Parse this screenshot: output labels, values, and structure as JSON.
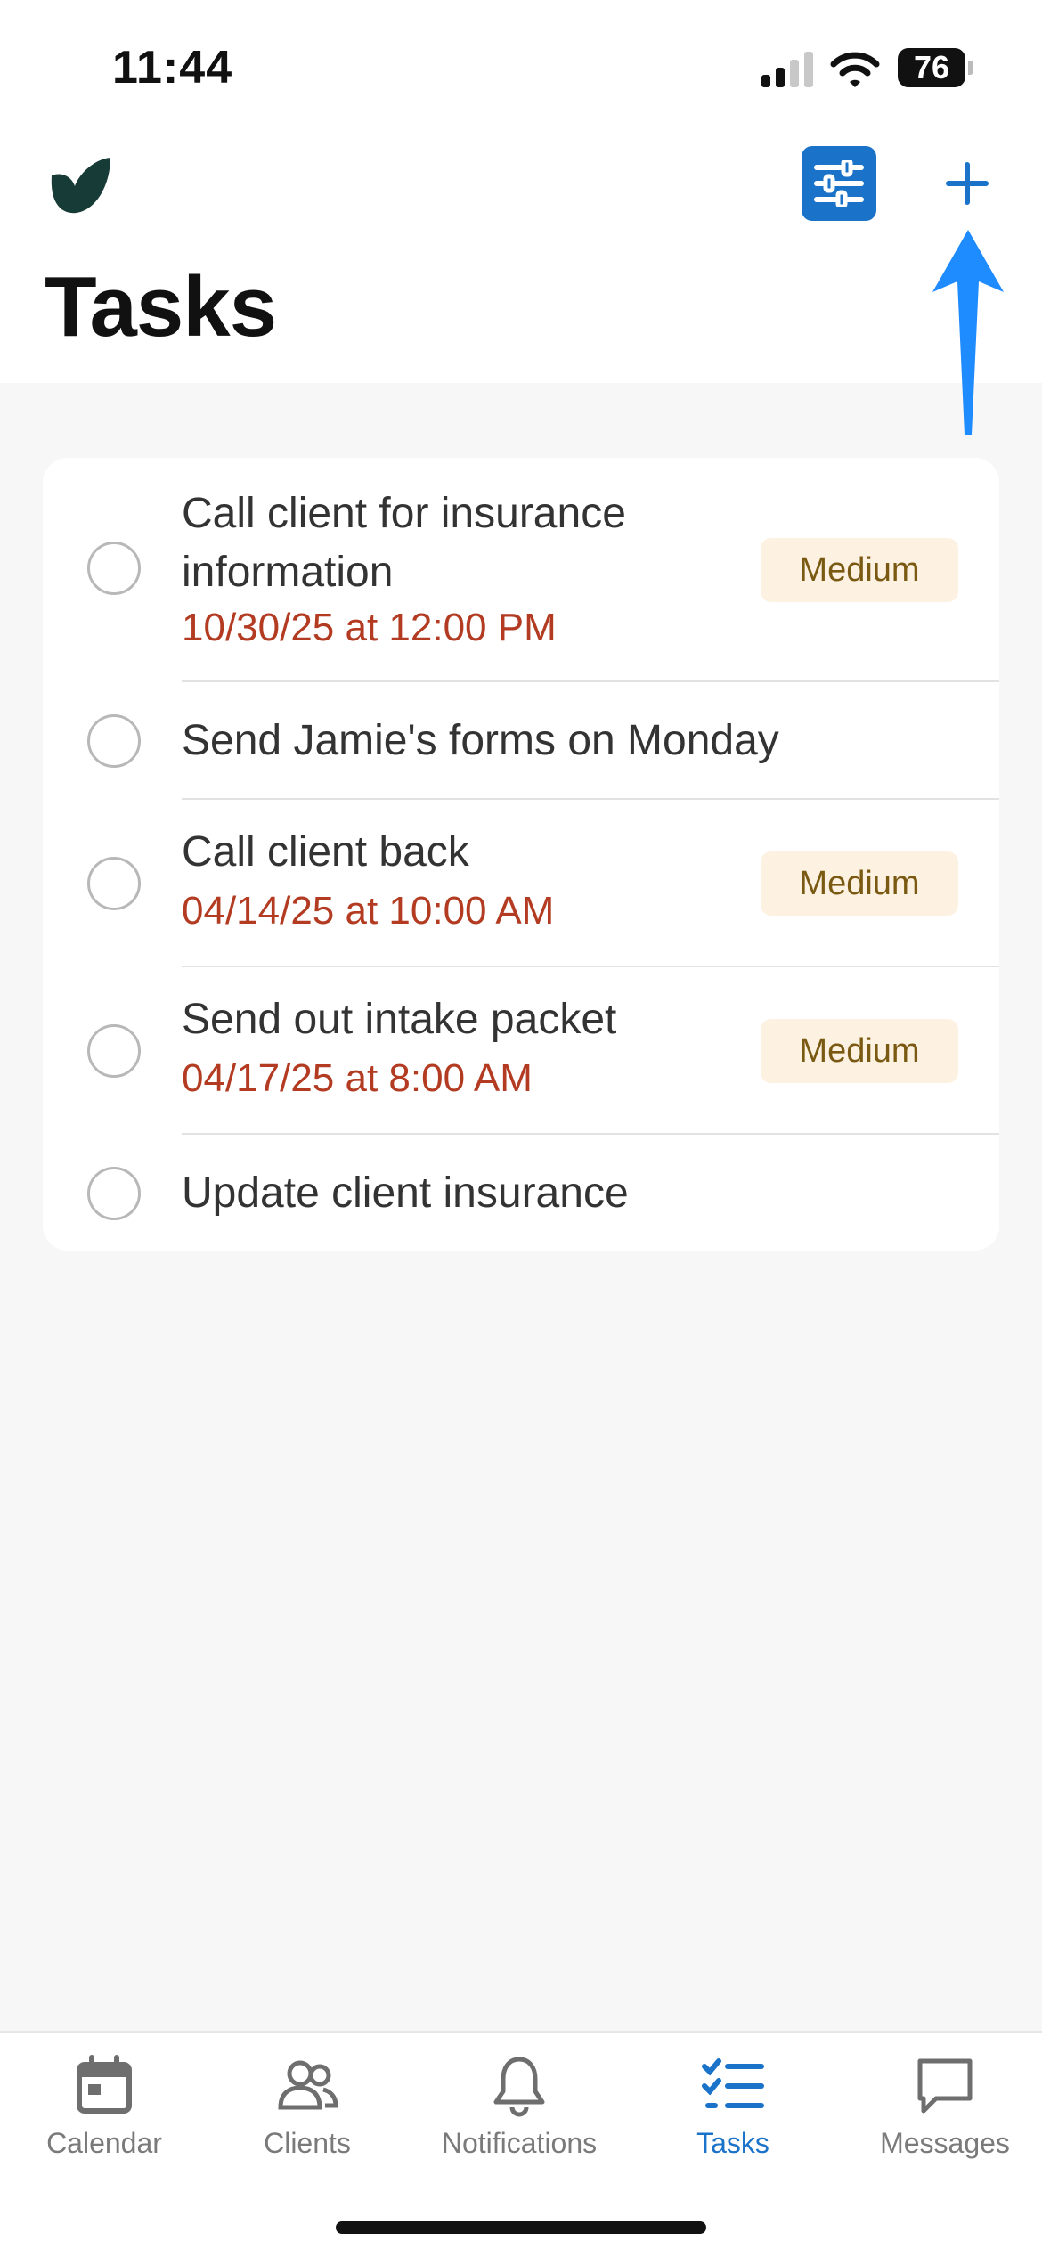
{
  "status": {
    "time": "11:44",
    "battery": "76"
  },
  "header": {
    "title": "Tasks"
  },
  "tasks": [
    {
      "title": "Call client for insurance information",
      "due": "10/30/25 at 12:00 PM",
      "priority": "Medium"
    },
    {
      "title": "Send Jamie's forms on Monday",
      "due": "",
      "priority": ""
    },
    {
      "title": "Call client back",
      "due": "04/14/25 at 10:00 AM",
      "priority": "Medium"
    },
    {
      "title": "Send out intake packet",
      "due": "04/17/25 at 8:00 AM",
      "priority": "Medium"
    },
    {
      "title": "Update client insurance",
      "due": "",
      "priority": ""
    }
  ],
  "tabs": [
    {
      "label": "Calendar",
      "icon": "calendar-icon"
    },
    {
      "label": "Clients",
      "icon": "clients-icon"
    },
    {
      "label": "Notifications",
      "icon": "bell-icon"
    },
    {
      "label": "Tasks",
      "icon": "tasks-icon",
      "active": true
    },
    {
      "label": "Messages",
      "icon": "message-icon"
    }
  ],
  "colors": {
    "accent": "#1a72c9",
    "due_date": "#b23b22",
    "badge_bg": "#fdf1e1",
    "badge_text": "#7a5a12",
    "annotation_arrow": "#1e8bff"
  }
}
